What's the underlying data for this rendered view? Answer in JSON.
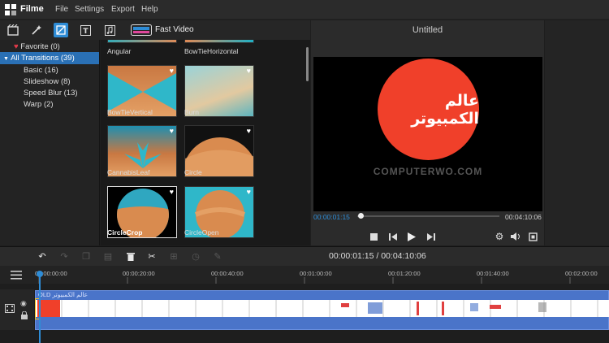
{
  "app": {
    "title": "Filme"
  },
  "menu": [
    "File",
    "Settings",
    "Export",
    "Help"
  ],
  "toolbar": {
    "fast_video_label": "Fast Video"
  },
  "sidebar": {
    "favorite": "Favorite (0)",
    "all": "All Transitions (39)",
    "items": [
      "Basic (16)",
      "Slideshow (8)",
      "Speed Blur (13)",
      "Warp (2)"
    ]
  },
  "gallery": {
    "top_labels": [
      "Angular",
      "BowTieHorizontal"
    ],
    "rows": [
      [
        "BowTieVertical",
        "Burn"
      ],
      [
        "CannabisLeaf",
        "Circle"
      ],
      [
        "CircleCrop",
        "CircleOpen"
      ]
    ],
    "selected": "CircleCrop"
  },
  "preview": {
    "title": "Untitled",
    "logo_text": "عالم الكمبيوتر",
    "watermark": "COMPUTERWO.COM",
    "current_time": "00:00:01:15",
    "total_time": "00:04:10:06",
    "progress_fraction": 0.02
  },
  "timeline": {
    "time_display": "00:00:01:15 / 00:04:10:06",
    "ticks": [
      "00:00:00:00",
      "00:00:20:00",
      "00:00:40:00",
      "00:01:00:00",
      "00:01:20:00",
      "00:01:40:00",
      "00:02:00:00"
    ],
    "clip_name": "OLD عالم الكمبيوتر"
  },
  "colors": {
    "accent": "#2e8cd6",
    "selection": "#2a70b5",
    "clip": "#4a74c9",
    "logo_red": "#f0402a"
  },
  "icons": [
    "film-icon",
    "magic-icon",
    "transition-icon",
    "text-icon",
    "music-icon",
    "fast-video-icon",
    "heart-icon",
    "undo-icon",
    "redo-icon",
    "copy-icon",
    "paste-icon",
    "delete-icon",
    "cut-icon",
    "crop-icon",
    "speed-icon",
    "edit-icon",
    "stop-icon",
    "prev-frame-icon",
    "play-icon",
    "next-frame-icon",
    "settings-icon",
    "volume-icon",
    "fullscreen-icon",
    "hamburger-icon",
    "eye-icon",
    "lock-icon"
  ]
}
